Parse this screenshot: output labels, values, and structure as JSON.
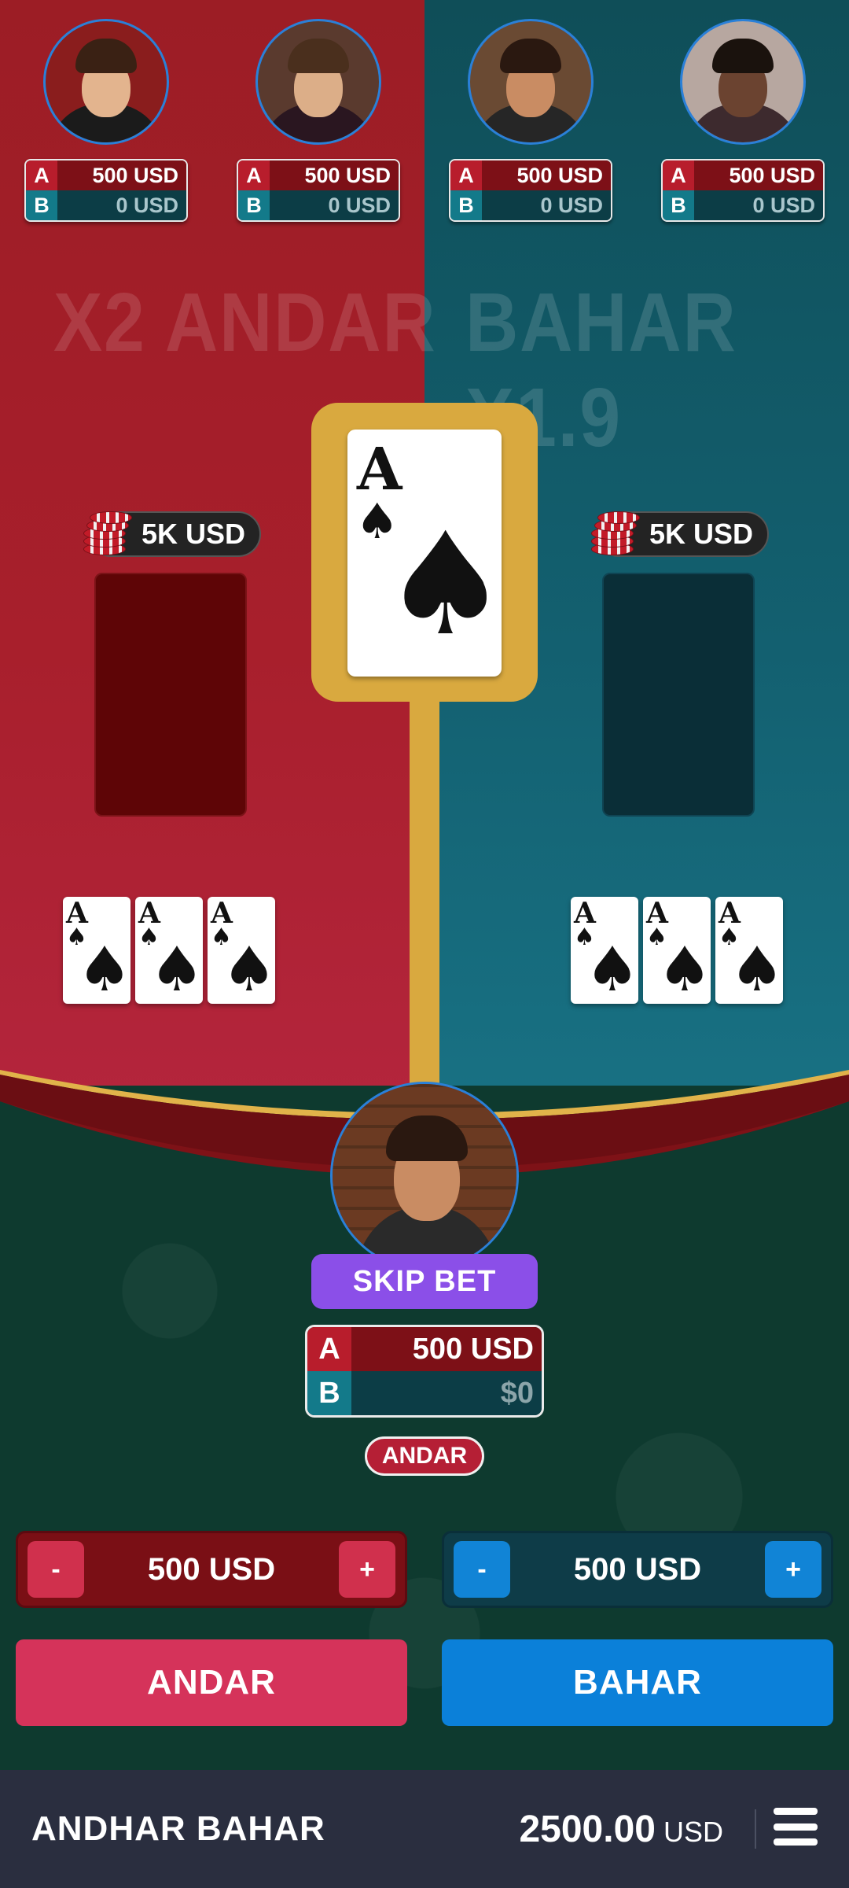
{
  "players": [
    {
      "a_tag": "A",
      "a_amount": "500 USD",
      "b_tag": "B",
      "b_amount": "0 USD",
      "skin": "#e3b48e",
      "hair": "#3a2114",
      "outfit": "#1b1b1b",
      "bg": "#8a1d1d"
    },
    {
      "a_tag": "A",
      "a_amount": "500 USD",
      "b_tag": "B",
      "b_amount": "0 USD",
      "skin": "#dcae88",
      "hair": "#4a2f1d",
      "outfit": "#2a1620",
      "bg": "#5a3a2e"
    },
    {
      "a_tag": "A",
      "a_amount": "500 USD",
      "b_tag": "B",
      "b_amount": "0 USD",
      "skin": "#c98c63",
      "hair": "#2a1810",
      "outfit": "#262626",
      "bg": "#6a4a33"
    },
    {
      "a_tag": "A",
      "a_amount": "500 USD",
      "b_tag": "B",
      "b_amount": "0 USD",
      "skin": "#6b4330",
      "hair": "#1a120d",
      "outfit": "#3d2a2e",
      "bg": "#b7a7a0"
    }
  ],
  "titles": {
    "left": "X2 ANDAR",
    "right": "BAHAR X1.9"
  },
  "joker_card": {
    "rank": "A",
    "suit": "♠"
  },
  "stacks": {
    "left": "5K USD",
    "right": "5K USD"
  },
  "andar_cards": [
    {
      "rank": "A",
      "suit": "♠"
    },
    {
      "rank": "A",
      "suit": "♠"
    },
    {
      "rank": "A",
      "suit": "♠"
    }
  ],
  "bahar_cards": [
    {
      "rank": "A",
      "suit": "♠"
    },
    {
      "rank": "A",
      "suit": "♠"
    },
    {
      "rank": "A",
      "suit": "♠"
    }
  ],
  "me": {
    "skip_label": "SKIP BET",
    "a_tag": "A",
    "a_amount": "500 USD",
    "b_tag": "B",
    "b_amount": "$0",
    "side": "ANDAR"
  },
  "steppers": {
    "left": {
      "minus": "-",
      "value": "500 USD",
      "plus": "+"
    },
    "right": {
      "minus": "-",
      "value": "500 USD",
      "plus": "+"
    }
  },
  "buttons": {
    "andar": "ANDAR",
    "bahar": "BAHAR"
  },
  "bottom_bar": {
    "game_name": "ANDHAR BAHAR",
    "balance": "2500.00",
    "currency": "USD"
  },
  "colors": {
    "andar": "#a81f2c",
    "bahar": "#136070",
    "gold": "#d9a93f",
    "skip": "#8b4fe8"
  }
}
